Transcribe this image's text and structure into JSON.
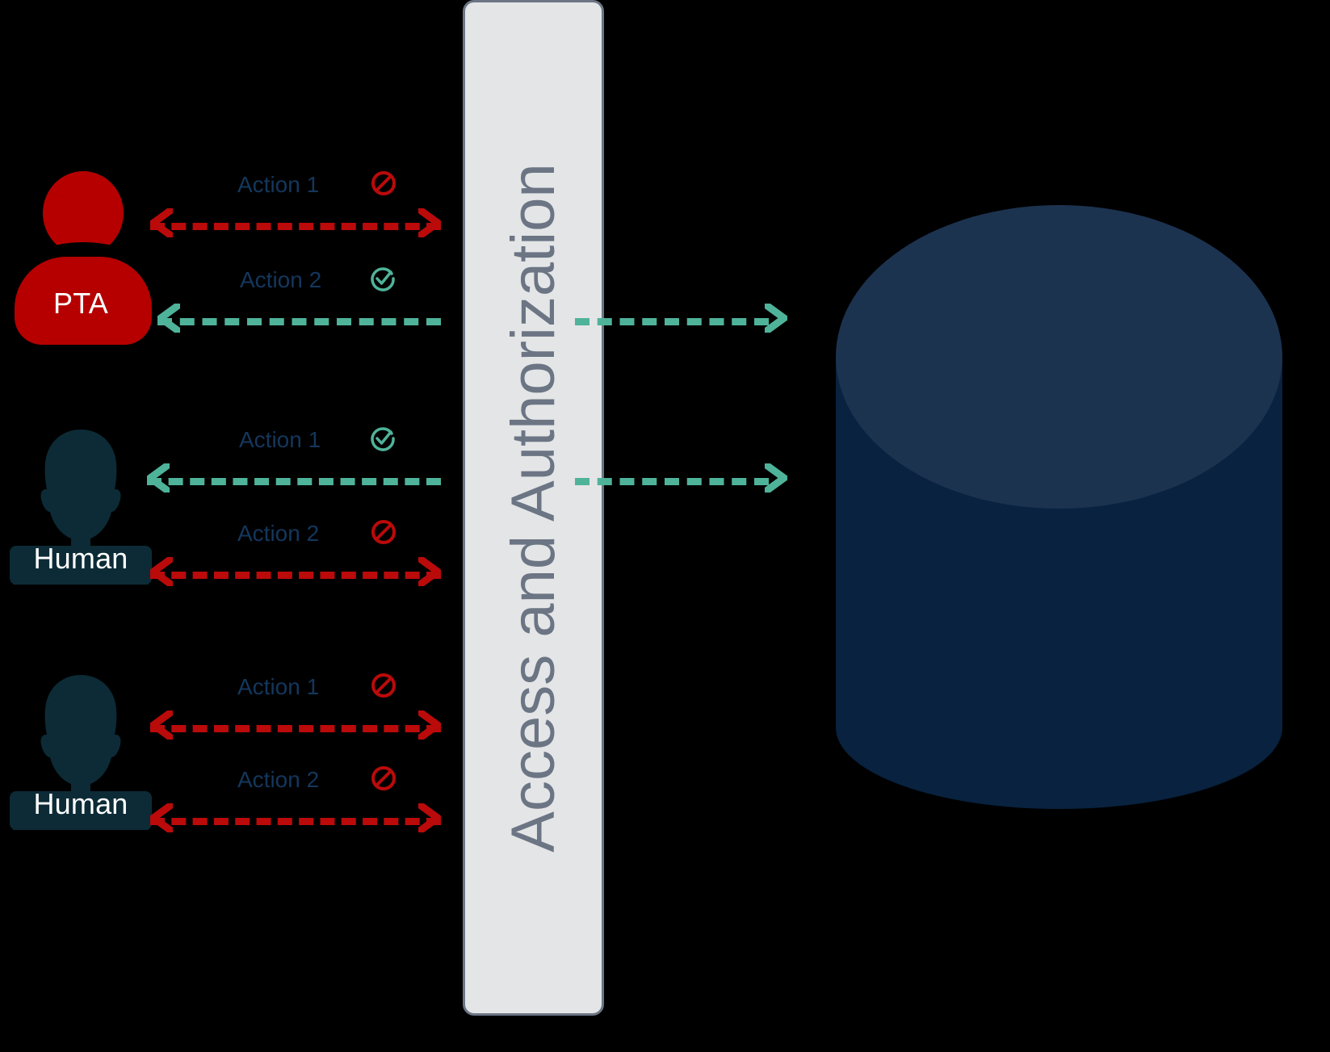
{
  "diagram": {
    "title": "Access and Authorization",
    "background_color": "#000000",
    "gate": {
      "label": "Access and Authorization",
      "fill_color": "#e4e5e6",
      "border_color": "#6b7584",
      "text_color": "#6b7584"
    },
    "datastore": {
      "name": "database-cylinder",
      "top_color": "#1c3350",
      "body_color": "#08223f"
    },
    "colors": {
      "denied": "#bb0a0a",
      "allowed": "#4fb39a",
      "actor_pta": "#b60000",
      "actor_human": "#0c2b36",
      "action_label": "#14375c",
      "actor_label": "#ffffff"
    },
    "actors": [
      {
        "id": "pta",
        "label": "PTA",
        "kind": "pta-icon",
        "color": "#b60000"
      },
      {
        "id": "human-1",
        "label": "Human",
        "kind": "human-icon",
        "color": "#0c2b36"
      },
      {
        "id": "human-2",
        "label": "Human",
        "kind": "human-icon",
        "color": "#0c2b36"
      }
    ],
    "connections": [
      {
        "actor": "PTA",
        "action": "Action 1",
        "status": "denied",
        "status_icon": "prohibited-icon",
        "reaches_datastore": false
      },
      {
        "actor": "PTA",
        "action": "Action 2",
        "status": "allowed",
        "status_icon": "check-circle-icon",
        "reaches_datastore": true
      },
      {
        "actor": "Human",
        "action": "Action 1",
        "status": "allowed",
        "status_icon": "check-circle-icon",
        "reaches_datastore": true
      },
      {
        "actor": "Human",
        "action": "Action 2",
        "status": "denied",
        "status_icon": "prohibited-icon",
        "reaches_datastore": false
      },
      {
        "actor": "Human",
        "action": "Action 1",
        "status": "denied",
        "status_icon": "prohibited-icon",
        "reaches_datastore": false
      },
      {
        "actor": "Human",
        "action": "Action 2",
        "status": "denied",
        "status_icon": "prohibited-icon",
        "reaches_datastore": false
      }
    ]
  }
}
